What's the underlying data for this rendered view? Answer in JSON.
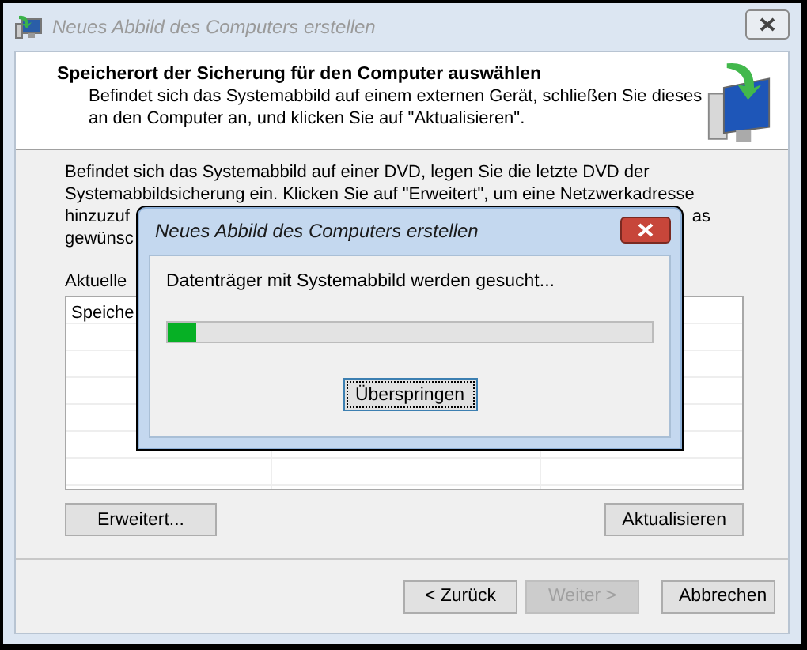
{
  "window": {
    "title": "Neues Abbild des Computers erstellen",
    "active": false
  },
  "header": {
    "title": "Speicherort der Sicherung für den Computer auswählen",
    "description": "Befindet sich das Systemabbild auf einem externen Gerät, schließen Sie dieses an den Computer an, und klicken Sie auf \"Aktualisieren\"."
  },
  "instructions": {
    "lines": [
      {
        "left": "Befindet sich das Systemabbild auf einer DVD, legen Sie die letzte DVD der"
      },
      {
        "left": "Systemabbildsicherung ein. Klicken Sie auf \"Erweitert\", um eine Netzwerkadresse"
      },
      {
        "left": "hinzuzuf",
        "right": "as"
      },
      {
        "left": "gewünsc"
      }
    ]
  },
  "list_label": "Aktuelle",
  "list": {
    "columns": [
      "Speiche"
    ]
  },
  "body_buttons": [
    {
      "label": "Erweitert..."
    },
    {
      "label": "Aktualisieren"
    }
  ],
  "footer_buttons": [
    {
      "label": "< Zurück",
      "disabled": false
    },
    {
      "label": "Weiter >",
      "disabled": true
    },
    {
      "label": "Abbrechen",
      "disabled": false
    }
  ],
  "dialog": {
    "title": "Neues Abbild des Computers erstellen",
    "message": "Datenträger mit Systemabbild werden gesucht...",
    "progress": {
      "level": 0.06
    },
    "button": {
      "label": "Überspringen",
      "focused": true
    }
  }
}
